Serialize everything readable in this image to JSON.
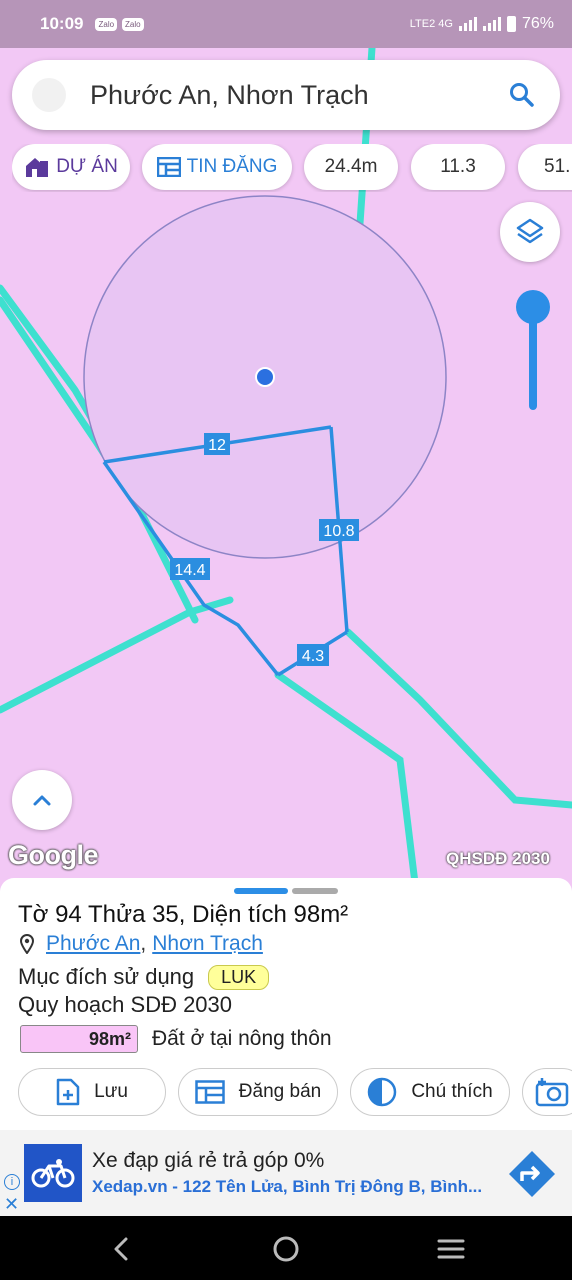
{
  "status_bar": {
    "time": "10:09",
    "notif_icons": [
      "Zalo",
      "Zalo"
    ],
    "network": "LTE2 4G",
    "battery": "76%"
  },
  "search": {
    "query": "Phước An, Nhơn Trạch"
  },
  "chips": [
    {
      "label": "DỰ ÁN",
      "icon": "house-icon"
    },
    {
      "label": "TIN ĐĂNG",
      "icon": "listing-icon"
    },
    {
      "label": "24.4m"
    },
    {
      "label": "11.3"
    },
    {
      "label": "51."
    }
  ],
  "map": {
    "labels": {
      "side_top": "12",
      "side_right": "10.8",
      "side_left": "14.4",
      "side_bottom": "4.3"
    },
    "attribution": "Google",
    "overlay_label": "QHSDĐ 2030",
    "land_color": "#f2c8f5",
    "road_color": "#3ee0cf",
    "plot_outline_color": "#2b8ee0"
  },
  "parcel": {
    "title": "Tờ 94 Thửa 35, Diện tích 98m²",
    "ward": "Phước An",
    "district": "Nhơn Trạch",
    "separator": ",",
    "purpose_label": "Mục đích sử dụng",
    "purpose_code": "LUK",
    "plan_label": "Quy hoạch SDĐ 2030",
    "plan_area": "98m²",
    "plan_use": "Đất ở tại nông thôn"
  },
  "actions": [
    {
      "label": "Lưu",
      "icon": "add-file-icon"
    },
    {
      "label": "Đăng bán",
      "icon": "listing-icon"
    },
    {
      "label": "Chú thích",
      "icon": "contrast-icon"
    },
    {
      "label": "",
      "icon": "add-photo-icon"
    }
  ],
  "ad": {
    "headline": "Xe đạp giá rẻ trả góp 0%",
    "subline": "Xedap.vn - 122 Tên Lửa, Bình Trị Đông B, Bình..."
  }
}
